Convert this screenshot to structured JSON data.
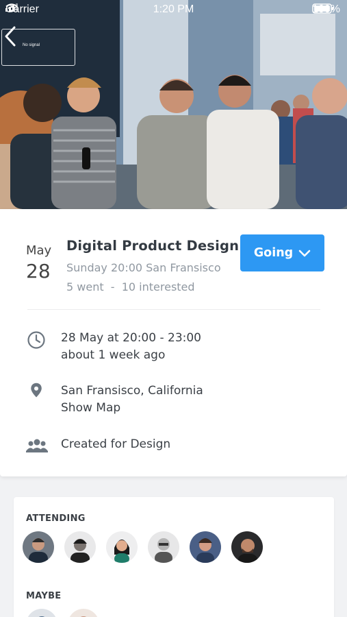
{
  "status_bar": {
    "carrier": "Carrier",
    "time": "1:20 PM",
    "battery": "100%"
  },
  "hero": {
    "screen_sign_text": "No signal"
  },
  "event": {
    "month": "May",
    "day": "28",
    "title": "Digital Product Design",
    "subtitle": "Sunday 20:00 San Fransisco",
    "stats": "5 went  -  10 interested",
    "rsvp_label": "Going"
  },
  "details": {
    "time_line1": "28 May at 20:00 - 23:00",
    "time_line2": "about 1 week ago",
    "location_line1": "San Fransisco, California",
    "location_line2": "Show Map",
    "group_line": "Created for Design"
  },
  "people": {
    "attending_label": "ATTENDING",
    "maybe_label": "MAYBE",
    "attending": [
      {
        "icon": "avatar-person-1",
        "bg": "#6f7882"
      },
      {
        "icon": "avatar-person-2",
        "bg": "#e9e9ea"
      },
      {
        "icon": "avatar-person-3",
        "bg": "#eeeeef"
      },
      {
        "icon": "avatar-person-4",
        "bg": "#e7e7e8"
      },
      {
        "icon": "avatar-person-5",
        "bg": "#4a5f86"
      },
      {
        "icon": "avatar-person-6",
        "bg": "#2a2a2c"
      }
    ]
  },
  "colors": {
    "accent": "#2d98f3",
    "muted_text": "#9098a1",
    "icon_gray": "#6c7680"
  }
}
